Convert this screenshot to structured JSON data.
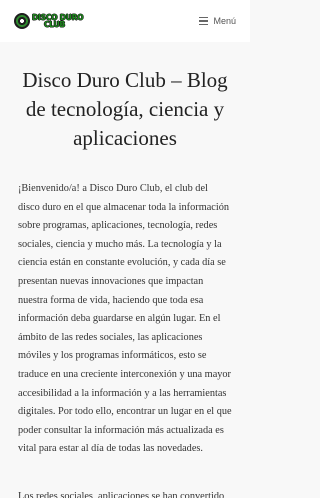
{
  "header": {
    "logo_line1": "DISCO DURO",
    "logo_line2": "CLUB",
    "menu_label": "Menú",
    "menu_icon": "hamburger-icon"
  },
  "main": {
    "title": "Disco Duro Club – Blog de tecnología, ciencia y aplicaciones",
    "intro": "¡Bienvenido/a! a Disco Duro Club, el club del disco duro en el que almacenar toda la información sobre programas, aplicaciones, tecnología, redes sociales, ciencia y mucho más. La tecnología y la ciencia están en constante evolución, y cada día se presentan nuevas innovaciones que impactan nuestra forma de vida, haciendo que toda esa información deba guardarse en algún lugar. En el ámbito de las redes sociales, las aplicaciones móviles y los programas informáticos, esto se traduce en una creciente interconexión y una mayor accesibilidad a la información y a las herramientas digitales. Por todo ello, encontrar un lugar en el que poder consultar la información más actualizada es vital para estar al día de todas las novedades.",
    "second_paragraph": "Los redes sociales, aplicaciones se han convertido"
  },
  "colors": {
    "logo_green": "#1e8a1e",
    "page_background": "#f8f8f8",
    "header_background": "#ffffff",
    "text": "#333333"
  }
}
